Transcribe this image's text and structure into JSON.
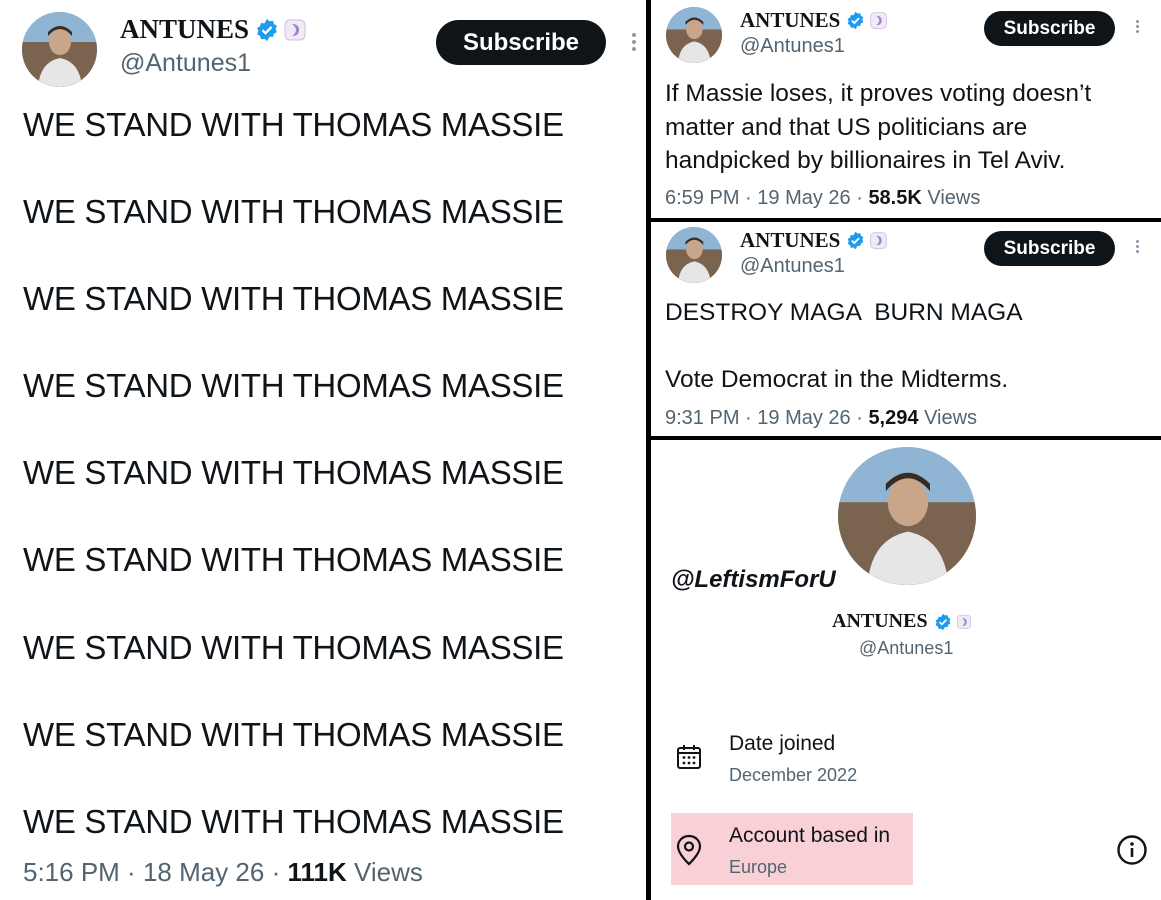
{
  "left_tweet": {
    "display_name": "ANTUNES",
    "handle": "@Antunes1",
    "subscribe_label": "Subscribe",
    "lines": [
      "WE STAND WITH THOMAS MASSIE",
      "WE STAND WITH THOMAS MASSIE",
      "WE STAND WITH THOMAS MASSIE",
      "WE STAND WITH THOMAS MASSIE",
      "WE STAND WITH THOMAS MASSIE",
      "WE STAND WITH THOMAS MASSIE",
      "WE STAND WITH THOMAS MASSIE",
      "WE STAND WITH THOMAS MASSIE",
      "WE STAND WITH THOMAS MASSIE"
    ],
    "time": "5:16 PM",
    "date": "18 May 26",
    "views_count": "111K",
    "views_label": "Views"
  },
  "tweet_two": {
    "display_name": "ANTUNES",
    "handle": "@Antunes1",
    "subscribe_label": "Subscribe",
    "text_lines": [
      "If Massie loses, it proves voting doesn’t",
      "matter and that US politicians are",
      "handpicked by billionaires in Tel Aviv."
    ],
    "time": "6:59 PM",
    "date": "19 May 26",
    "views_count": "58.5K",
    "views_label": "Views"
  },
  "tweet_three": {
    "display_name": "ANTUNES",
    "handle": "@Antunes1",
    "subscribe_label": "Subscribe",
    "line_one": "DESTROY MAGA  BURN MAGA",
    "line_two": "Vote Democrat in the Midterms.",
    "time": "9:31 PM",
    "date": "19 May 26",
    "views_count": "5,294",
    "views_label": "Views"
  },
  "profile": {
    "watermark": "@LeftismForU",
    "display_name": "ANTUNES",
    "handle": "@Antunes1",
    "date_joined_label": "Date joined",
    "date_joined_value": "December 2022",
    "based_in_label": "Account based in",
    "based_in_value": "Europe"
  },
  "icons": {
    "verified": "verified-badge-icon",
    "government": "affiliate-badge-icon",
    "more": "more-options-icon",
    "calendar": "calendar-icon",
    "location": "location-pin-icon",
    "info": "info-icon"
  },
  "colors": {
    "verified_blue": "#1d9bf0",
    "subscribe_bg": "#0f1419",
    "meta_gray": "#536471",
    "highlight_pink": "#f8d0d6"
  },
  "separator": " · "
}
